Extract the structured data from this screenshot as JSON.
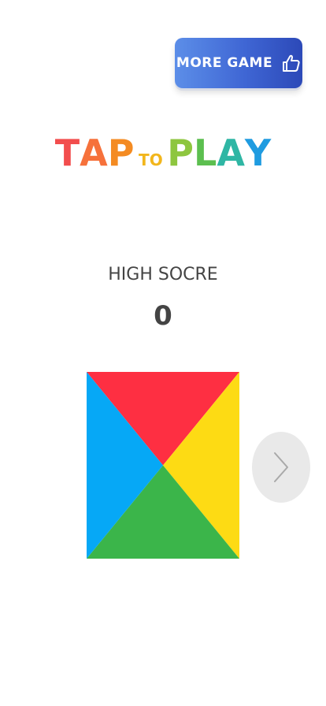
{
  "more_game": {
    "label": "MORE GAME",
    "icon": "thumbs-up-pointing-icon",
    "color_start": "#5c8ee8",
    "color_end": "#2c49b8"
  },
  "title": {
    "letters": [
      {
        "text": "T",
        "color": "#f24d4d",
        "size": "big"
      },
      {
        "text": "A",
        "color": "#f6713b",
        "size": "big"
      },
      {
        "text": "P",
        "color": "#f48b22",
        "size": "big"
      },
      {
        "text": "TO",
        "color": "#f2b61c",
        "size": "small"
      },
      {
        "text": "P",
        "color": "#8ec63f",
        "size": "big"
      },
      {
        "text": "L",
        "color": "#5cbf4f",
        "size": "big"
      },
      {
        "text": "A",
        "color": "#2fb6a4",
        "size": "big"
      },
      {
        "text": "Y",
        "color": "#1f9be0",
        "size": "big"
      }
    ]
  },
  "high_score": {
    "label": "HIGH SOCRE",
    "value": "0"
  },
  "board": {
    "colors": {
      "top": "#fe2f42",
      "right": "#fddb14",
      "bottom": "#3bb54a",
      "left": "#06a8f6"
    }
  },
  "next": {
    "icon": "chevron-right-icon"
  }
}
